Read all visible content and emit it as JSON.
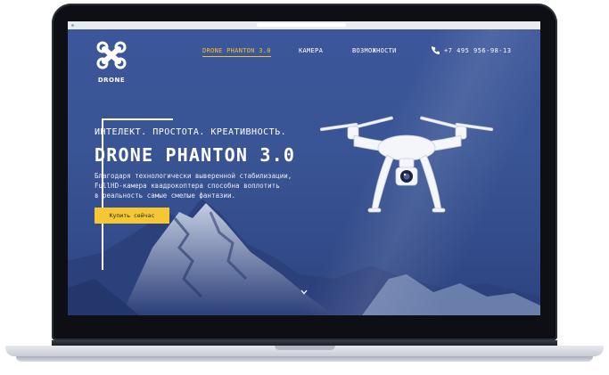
{
  "logo": {
    "text": "DRONE",
    "icon": "drone-x-icon"
  },
  "nav": {
    "items": [
      {
        "label": "DRONE PHANTON 3.0",
        "active": true
      },
      {
        "label": "КАМЕРА",
        "active": false
      },
      {
        "label": "ВОЗМОЖНОСТИ",
        "active": false
      }
    ]
  },
  "contact": {
    "phone": "+7 495 956-98-13",
    "icon": "phone-icon"
  },
  "hero": {
    "tagline": "ИНТЕЛЕКТ. ПРОСТОТА. КРЕАТИВНОСТЬ.",
    "headline": "DRONE PHANTON 3.0",
    "description_lines": [
      "Благодаря технологически выверенной стабилизации,",
      "FullHD-камера квадрокоптера способна воплотить",
      "в реальность самые смелые фантазии."
    ],
    "cta_label": "Купить сейчас",
    "scroll_icon": "chevron-down-icon"
  },
  "colors": {
    "accent": "#f5c732",
    "hero_bg": "#3a5595",
    "text": "#ffffff"
  }
}
